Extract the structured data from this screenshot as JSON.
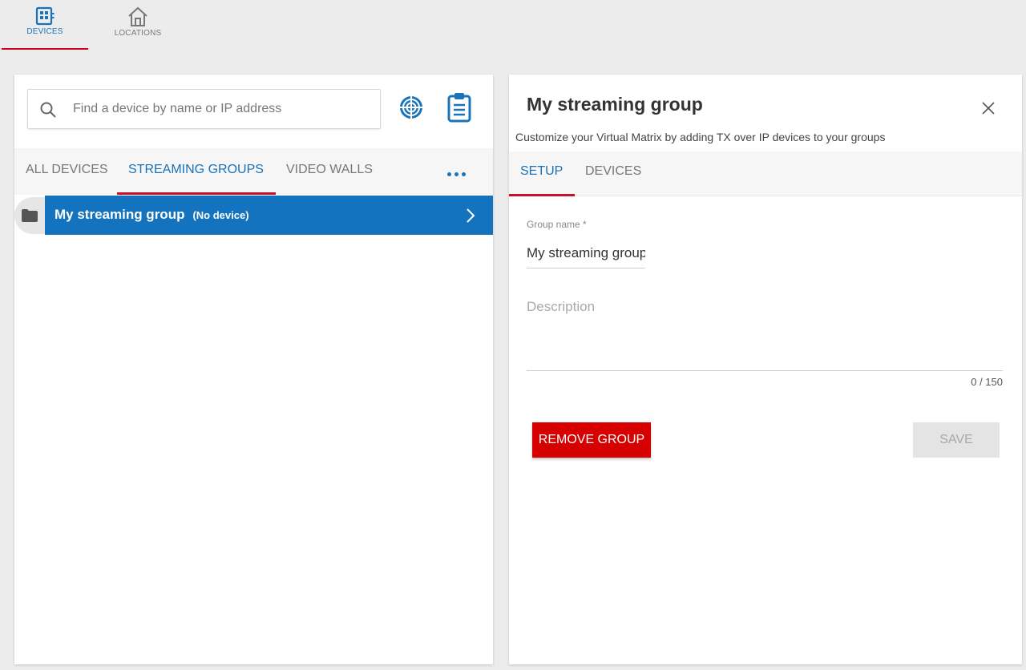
{
  "nav": {
    "items": [
      {
        "label": "DEVICES",
        "icon": "devices-icon",
        "active": true
      },
      {
        "label": "LOCATIONS",
        "icon": "home-icon",
        "active": false
      }
    ]
  },
  "search": {
    "placeholder": "Find a device by name or IP address",
    "value": ""
  },
  "left_tabs": [
    {
      "label": "ALL DEVICES",
      "active": false
    },
    {
      "label": "STREAMING GROUPS",
      "active": true
    },
    {
      "label": "VIDEO WALLS",
      "active": false
    }
  ],
  "groups": [
    {
      "name": "My streaming group",
      "status": "(No device)",
      "selected": true
    }
  ],
  "detail": {
    "title": "My streaming group",
    "subtitle": "Customize your Virtual Matrix by adding TX over IP devices to your groups",
    "tabs": [
      {
        "label": "SETUP",
        "active": true
      },
      {
        "label": "DEVICES",
        "active": false
      }
    ],
    "group_name_label": "Group name *",
    "group_name_value": "My streaming group",
    "description_placeholder": "Description",
    "description_value": "",
    "char_count": "0 / 150",
    "remove_label": "REMOVE GROUP",
    "save_label": "SAVE"
  },
  "colors": {
    "accent_blue": "#1473bf",
    "accent_red": "#c8102e",
    "danger": "#d60000"
  }
}
